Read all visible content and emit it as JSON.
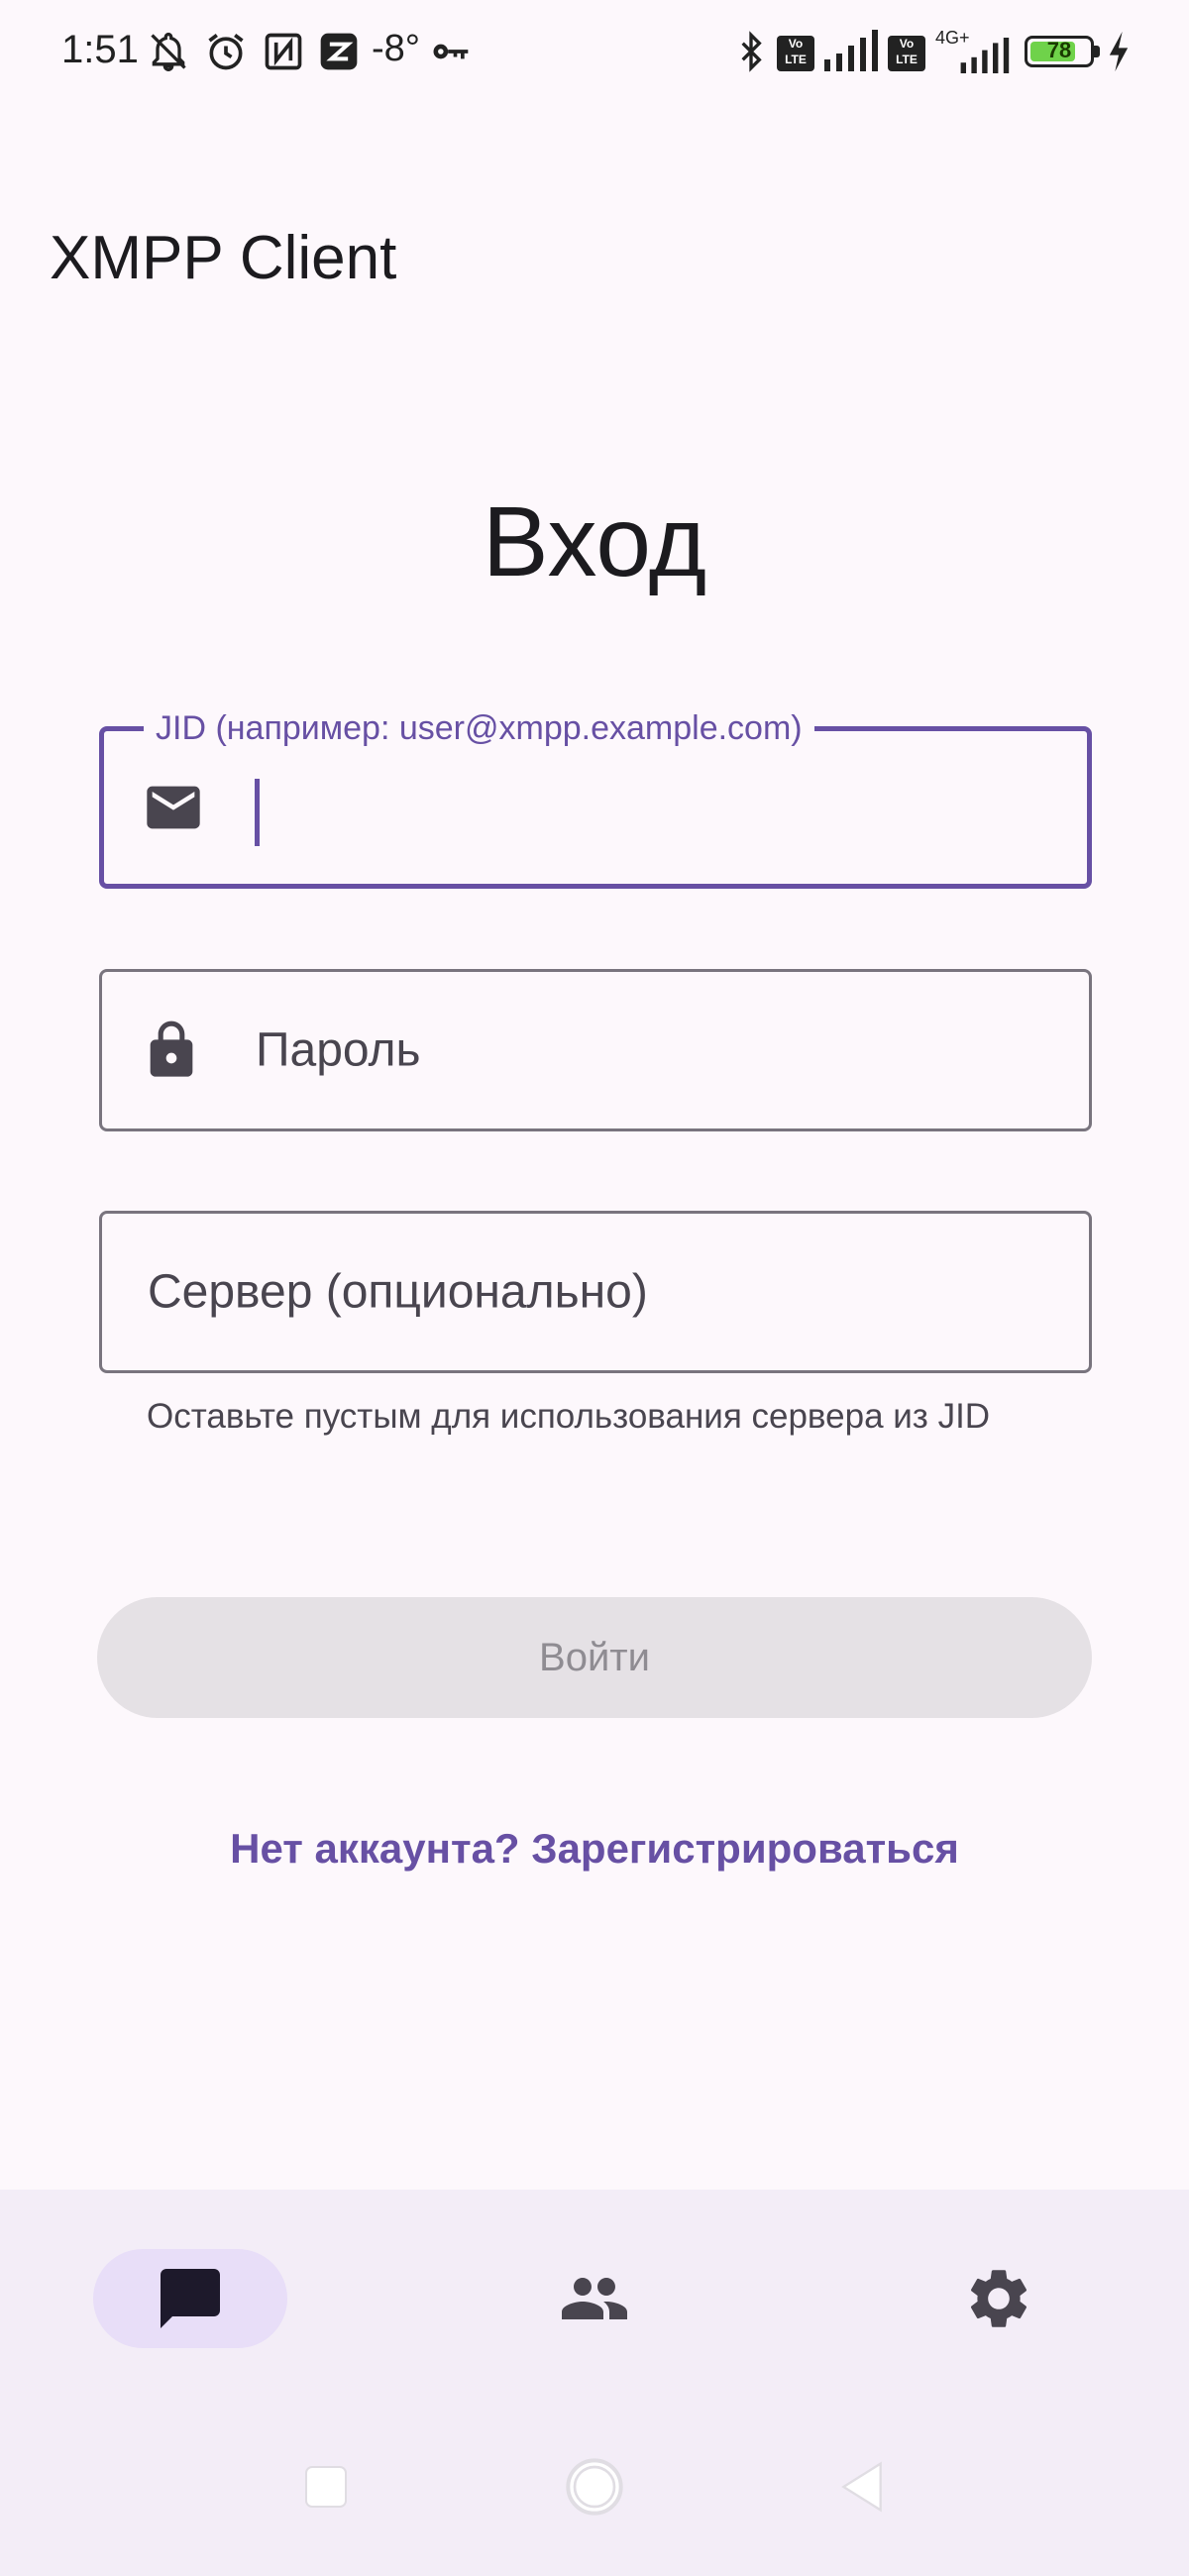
{
  "status_bar": {
    "time": "1:51",
    "temperature": "-8°",
    "battery": "78",
    "battery_level_percent": 78,
    "icons": [
      "bell-muted-icon",
      "alarm-icon",
      "nfc-icon",
      "app-notification-icon",
      "key-icon",
      "bluetooth-icon",
      "volte-icon",
      "signal-icon",
      "volte-icon",
      "4g-plus-signal-icon",
      "battery-icon",
      "charging-icon"
    ],
    "network_label": "4G+",
    "volte_label_top": "Vo",
    "volte_label_bottom": "LTE"
  },
  "app_bar": {
    "title": "XMPP Client"
  },
  "login": {
    "heading": "Вход",
    "jid_field": {
      "label": "JID (например: user@xmpp.example.com)",
      "value": "",
      "icon": "mail-icon"
    },
    "password_field": {
      "placeholder": "Пароль",
      "icon": "lock-icon"
    },
    "server_field": {
      "placeholder": "Сервер (опционально)"
    },
    "server_helper": "Оставьте пустым для использования сервера из JID",
    "login_button": "Войти",
    "register_link": "Нет аккаунта? Зарегистрироваться"
  },
  "bottom_nav": {
    "items": [
      {
        "name": "chats",
        "icon": "chat-icon",
        "active": true
      },
      {
        "name": "contacts",
        "icon": "people-icon",
        "active": false
      },
      {
        "name": "settings",
        "icon": "gear-icon",
        "active": false
      }
    ]
  },
  "colors": {
    "primary": "#6750a4",
    "background": "#fdf8fc",
    "nav_background": "#f3edf7",
    "nav_active_indicator": "#e8def8",
    "disabled_button": "#e5e1e5"
  }
}
